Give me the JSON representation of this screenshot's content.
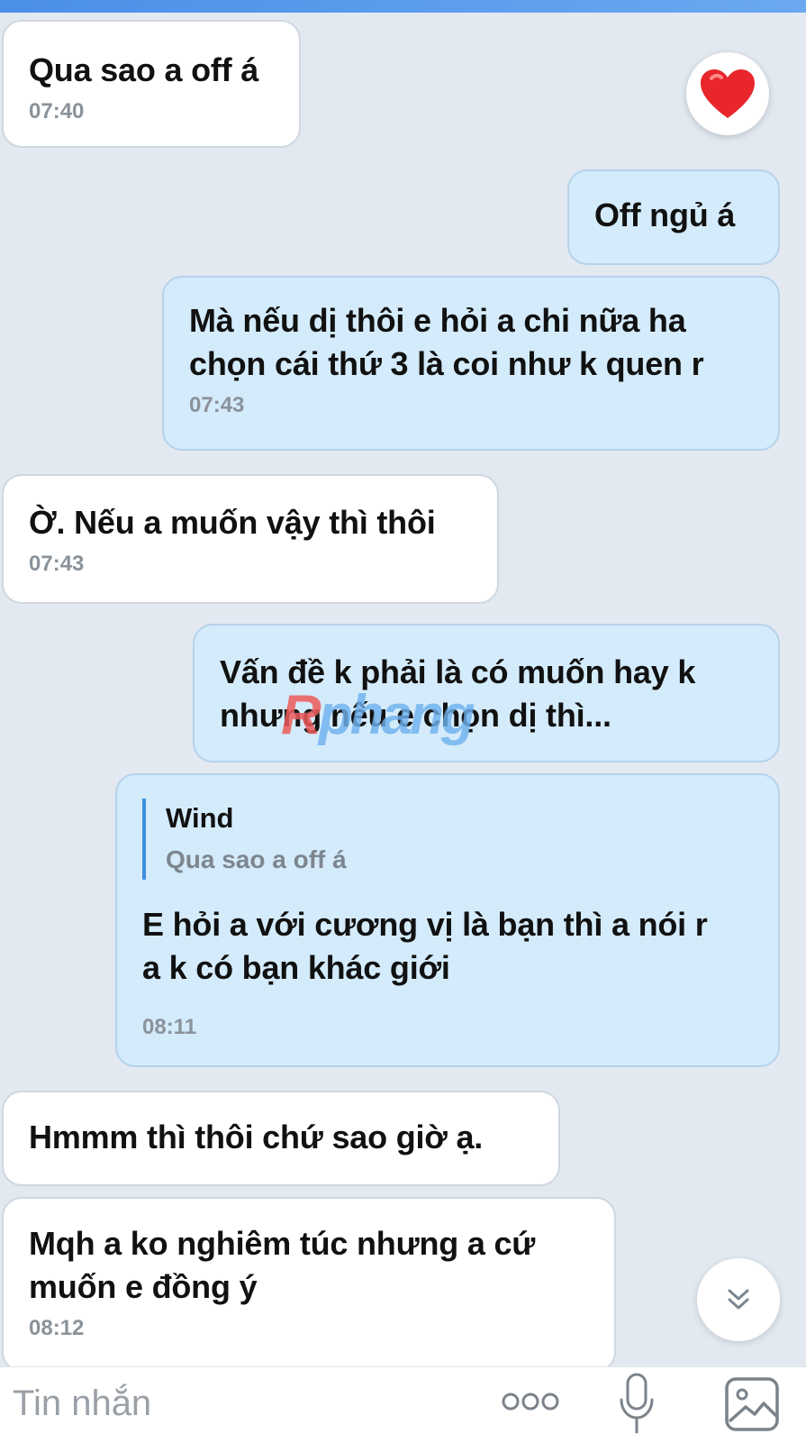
{
  "messages": [
    {
      "dir": "in",
      "text": "Qua sao a off á",
      "time": "07:40"
    },
    {
      "dir": "out",
      "text": "Off ngủ á",
      "time": ""
    },
    {
      "dir": "out",
      "text": "Mà nếu dị thôi e hỏi a chi nữa ha\nchọn cái thứ 3 là coi như k quen r",
      "time": "07:43"
    },
    {
      "dir": "in",
      "text": "Ờ. Nếu a muốn vậy thì thôi",
      "time": "07:43"
    },
    {
      "dir": "out",
      "text": "Vấn đề k phải là có muốn hay k\nnhưng nếu e chọn dị thì...",
      "time": ""
    },
    {
      "dir": "out",
      "text": "E hỏi a với cương vị là bạn thì a nói r\na k có bạn khác giới",
      "time": "08:11",
      "quote": {
        "name": "Wind",
        "text": "Qua sao a off á"
      }
    },
    {
      "dir": "in",
      "text": "Hmmm thì thôi chứ sao giờ ạ.",
      "time": ""
    },
    {
      "dir": "in",
      "text": "Mqh a ko nghiêm túc nhưng a cứ\nmuốn e đồng ý",
      "time": "08:12"
    }
  ],
  "reaction": {
    "emoji": "heart-icon"
  },
  "watermark": {
    "part1": "R",
    "part2": "phang"
  },
  "input": {
    "placeholder": "Tin nhắn"
  },
  "colors": {
    "incoming": "#ffffff",
    "outgoing": "#d4ebfb",
    "background": "#e2e9f1",
    "accent": "#3d8ee0"
  }
}
